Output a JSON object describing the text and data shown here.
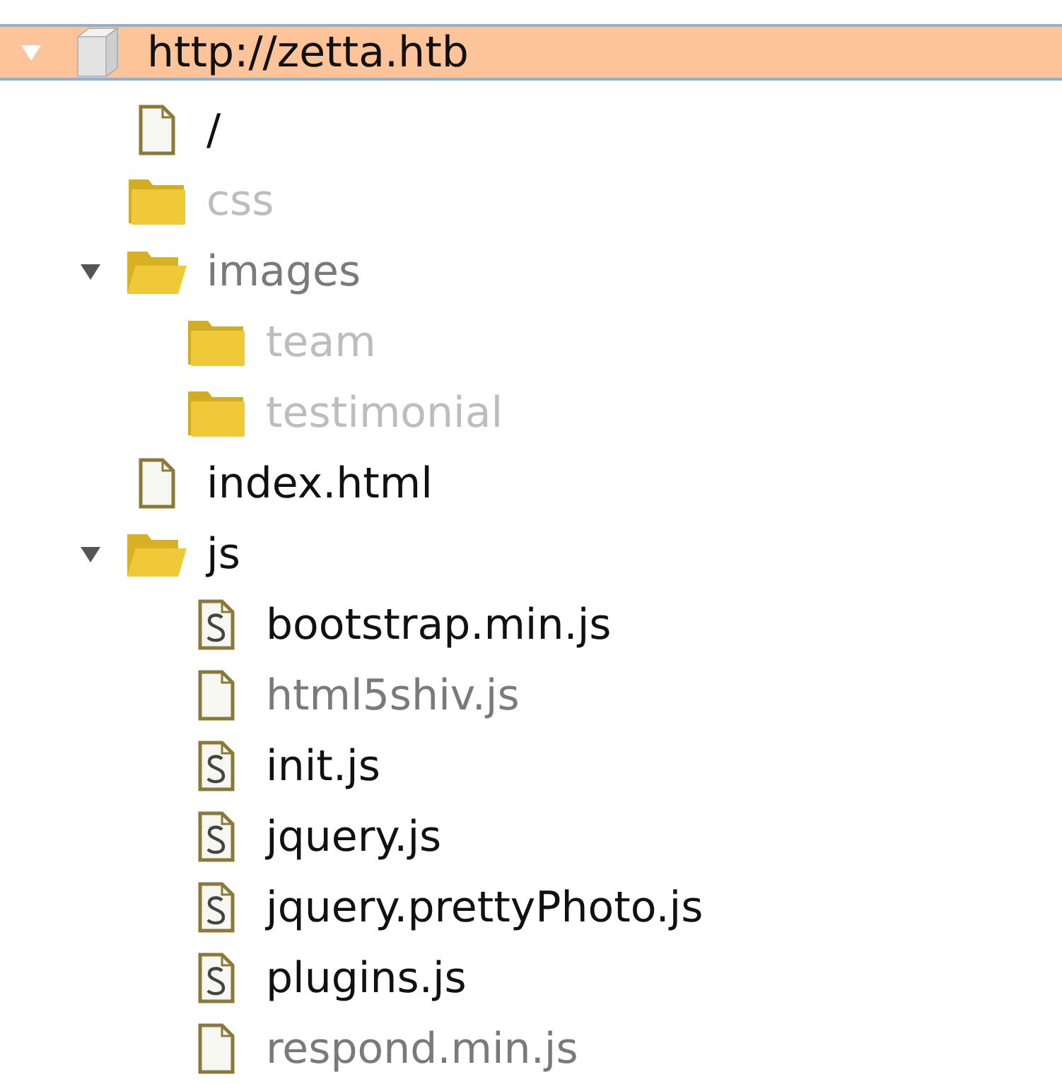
{
  "site_map": {
    "items": [
      {
        "label": "http://zetta.htb",
        "kind": "host",
        "requested": true,
        "selected": true,
        "expanded": true,
        "children": [
          {
            "label": "/",
            "kind": "file",
            "requested": true,
            "selected": false
          },
          {
            "label": "css",
            "kind": "folder",
            "requested": false,
            "empty": true,
            "selected": false
          },
          {
            "label": "images",
            "kind": "folder",
            "requested": false,
            "empty": false,
            "selected": false,
            "expanded": true,
            "children": [
              {
                "label": "team",
                "kind": "folder",
                "requested": false,
                "empty": true,
                "selected": false
              },
              {
                "label": "testimonial",
                "kind": "folder",
                "requested": false,
                "empty": true,
                "selected": false
              }
            ]
          },
          {
            "label": "index.html",
            "kind": "file",
            "requested": true,
            "selected": false
          },
          {
            "label": "js",
            "kind": "folder",
            "requested": true,
            "selected": false,
            "expanded": true,
            "children": [
              {
                "label": "bootstrap.min.js",
                "kind": "script",
                "requested": true,
                "selected": false
              },
              {
                "label": "html5shiv.js",
                "kind": "file",
                "requested": false,
                "empty": false,
                "selected": false
              },
              {
                "label": "init.js",
                "kind": "script",
                "requested": true,
                "selected": false
              },
              {
                "label": "jquery.js",
                "kind": "script",
                "requested": true,
                "selected": false
              },
              {
                "label": "jquery.prettyPhoto.js",
                "kind": "script",
                "requested": true,
                "selected": false
              },
              {
                "label": "plugins.js",
                "kind": "script",
                "requested": true,
                "selected": false
              },
              {
                "label": "respond.min.js",
                "kind": "file",
                "requested": false,
                "empty": false,
                "selected": false
              }
            ]
          }
        ]
      }
    ]
  }
}
